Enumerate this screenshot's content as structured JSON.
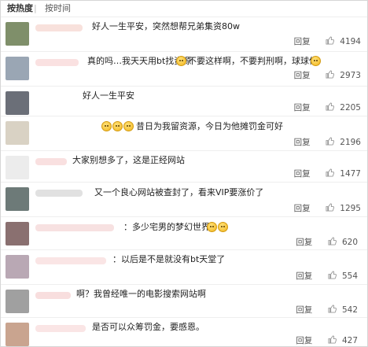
{
  "sort_bar": {
    "hot_label": "按热度",
    "separator": "|",
    "time_label": "按时间"
  },
  "reply_label": "回复",
  "comments": [
    {
      "text": "好人一生平安，突然想帮兄弟集资80w",
      "likes": "4194"
    },
    {
      "text_before": "真的吗…我天天用bt找资源",
      "text_mid": "不要这样啊，不要判刑啊，球球你",
      "likes": "2973"
    },
    {
      "text": "好人一生平安",
      "likes": "2205"
    },
    {
      "text": "昔日为我留资源，今日为他摊罚金可好",
      "likes": "2196"
    },
    {
      "text": "大家别想多了，这是正经网站",
      "likes": "1477"
    },
    {
      "text": "又一个良心网站被查封了，看来VIP要涨价了",
      "likes": "1295"
    },
    {
      "text": "：多少宅男的梦幻世界",
      "likes": "620"
    },
    {
      "text": "：以后是不是就没有bt天堂了",
      "likes": "554"
    },
    {
      "text": "啊？我曾经唯一的电影搜索网站啊",
      "likes": "542"
    },
    {
      "text": "是否可以众筹罚金，要感恩。",
      "likes": "427"
    }
  ],
  "colors": {
    "avatars": [
      "#7f8f6a",
      "#9aa6b4",
      "#6b6f78",
      "#d9d2c4",
      "#ececec",
      "#6d7a78",
      "#8a7070",
      "#b9a8b4",
      "#a0a0a0",
      "#c9a48f"
    ],
    "nicks": [
      "#f2c9c0",
      "#f5c8c8",
      "#ffffff",
      "#ffffff",
      "#f4c6c6",
      "#c8c8c8",
      "#f0c8c8",
      "#f6cfcf",
      "#f3c3c3",
      "#f5cfcf"
    ],
    "like_icon": "#999999"
  }
}
